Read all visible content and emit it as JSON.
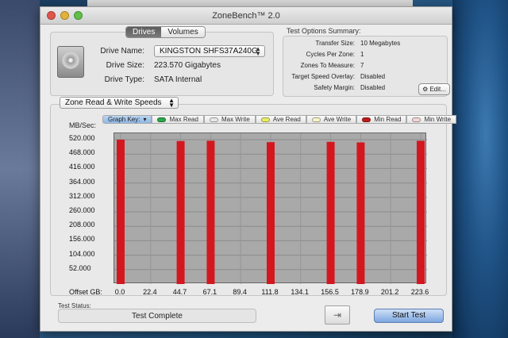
{
  "window": {
    "title": "ZoneBench™ 2.0"
  },
  "drive": {
    "tabs": [
      "Drives",
      "Volumes"
    ],
    "active_tab": "Drives",
    "name_label": "Drive Name:",
    "name_value": "KINGSTON SHFS37A240G",
    "size_label": "Drive Size:",
    "size_value": "223.570 Gigabytes",
    "type_label": "Drive Type:",
    "type_value": "SATA Internal"
  },
  "options": {
    "title": "Test Options Summary:",
    "rows": [
      {
        "k": "Transfer Size:",
        "v": "10 Megabytes"
      },
      {
        "k": "Cycles Per Zone:",
        "v": "1"
      },
      {
        "k": "Zones To Measure:",
        "v": "7"
      },
      {
        "k": "Target Speed Overlay:",
        "v": "Disabled"
      },
      {
        "k": "Safety Margin:",
        "v": "Disabled"
      }
    ],
    "edit_label": "Edit..."
  },
  "graph": {
    "mode": "Zone Read & Write Speeds",
    "key_label": "Graph Key:",
    "keys": [
      {
        "label": "Max Read",
        "color": "#2aa84a"
      },
      {
        "label": "Max Write",
        "color": "#e8e8e8"
      },
      {
        "label": "Ave Read",
        "color": "#e9ee6a"
      },
      {
        "label": "Ave Write",
        "color": "#f5f3c8"
      },
      {
        "label": "Min Read",
        "color": "#c01a1a"
      },
      {
        "label": "Min Write",
        "color": "#f2d6d6"
      }
    ]
  },
  "chart_data": {
    "type": "bar",
    "ylabel": "MB/Sec:",
    "xlabel": "Offset GB:",
    "ylim": [
      0,
      520
    ],
    "yticks": [
      "520.000",
      "468.000",
      "416.000",
      "364.000",
      "312.000",
      "260.000",
      "208.000",
      "156.000",
      "104.000",
      "52.000"
    ],
    "xticks": [
      "0.0",
      "22.4",
      "44.7",
      "67.1",
      "89.4",
      "111.8",
      "134.1",
      "156.5",
      "178.9",
      "201.2",
      "223.6"
    ],
    "x": [
      0.0,
      44.7,
      67.1,
      111.8,
      156.5,
      178.9,
      223.6
    ],
    "series": [
      {
        "name": "Min Read",
        "color": "#d4171f",
        "values": [
          520,
          515,
          516,
          511,
          512,
          510,
          516
        ]
      }
    ],
    "grid": true
  },
  "status": {
    "title": "Test Status:",
    "value": "Test Complete"
  },
  "actions": {
    "start_label": "Start Test"
  }
}
